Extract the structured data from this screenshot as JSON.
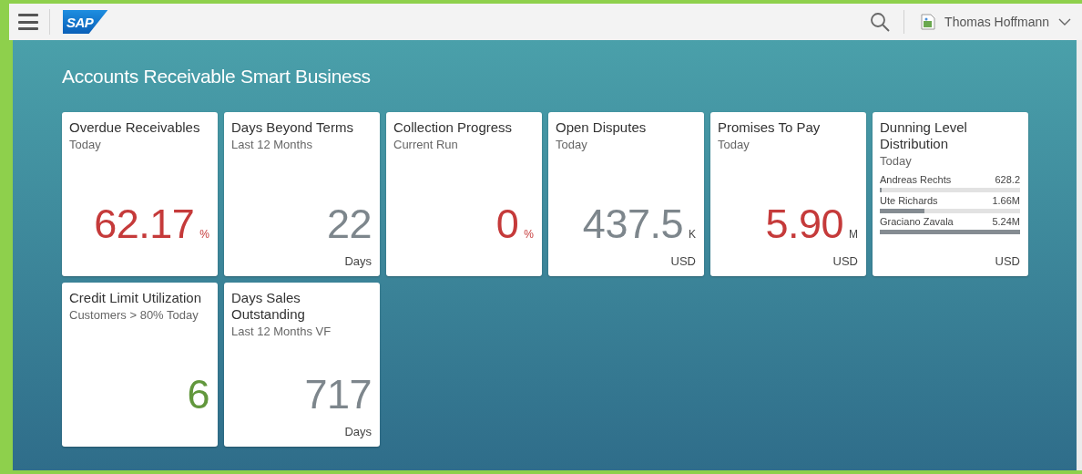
{
  "header": {
    "logo": "SAP",
    "user": "Thomas Hoffmann"
  },
  "page_title": "Accounts Receivable Smart Business",
  "tiles": [
    {
      "kind": "numeric",
      "title": "Overdue Receivables",
      "subtitle": "Today",
      "value": "62.17",
      "unit": "%",
      "color": "#c53a3a"
    },
    {
      "kind": "numeric",
      "title": "Days Beyond Terms",
      "subtitle": "Last 12 Months",
      "value": "22",
      "color": "#7d868c",
      "footer": "Days"
    },
    {
      "kind": "numeric",
      "title": "Collection Progress",
      "subtitle": "Current Run",
      "value": "0",
      "unit": "%",
      "color": "#c53a3a"
    },
    {
      "kind": "numeric",
      "title": "Open Disputes",
      "subtitle": "Today",
      "value": "437.5",
      "unit": "K",
      "color": "#7d868c",
      "footer": "USD"
    },
    {
      "kind": "numeric",
      "title": "Promises To Pay",
      "subtitle": "Today",
      "value": "5.90",
      "unit": "M",
      "color": "#c53a3a",
      "footer": "USD"
    },
    {
      "kind": "comparison",
      "title": "Dunning Level Distribution",
      "subtitle": "Today",
      "footer": "USD",
      "items": [
        {
          "name": "Andreas Rechts",
          "reading": "628.2",
          "level": 0.01
        },
        {
          "name": "Ute Richards",
          "reading": "1.66M",
          "level": 0.32
        },
        {
          "name": "Graciano Zavala",
          "reading": "5.24M",
          "level": 1
        }
      ]
    },
    {
      "kind": "numeric",
      "title": "Credit Limit Utilization",
      "subtitle": "Customers > 80% Today",
      "value": "6",
      "color": "#62973d"
    },
    {
      "kind": "numeric",
      "title": "Days Sales Outstanding",
      "subtitle": "Last 12 Months VF",
      "value": "717",
      "color": "#7d868c",
      "footer": "Days"
    }
  ]
}
